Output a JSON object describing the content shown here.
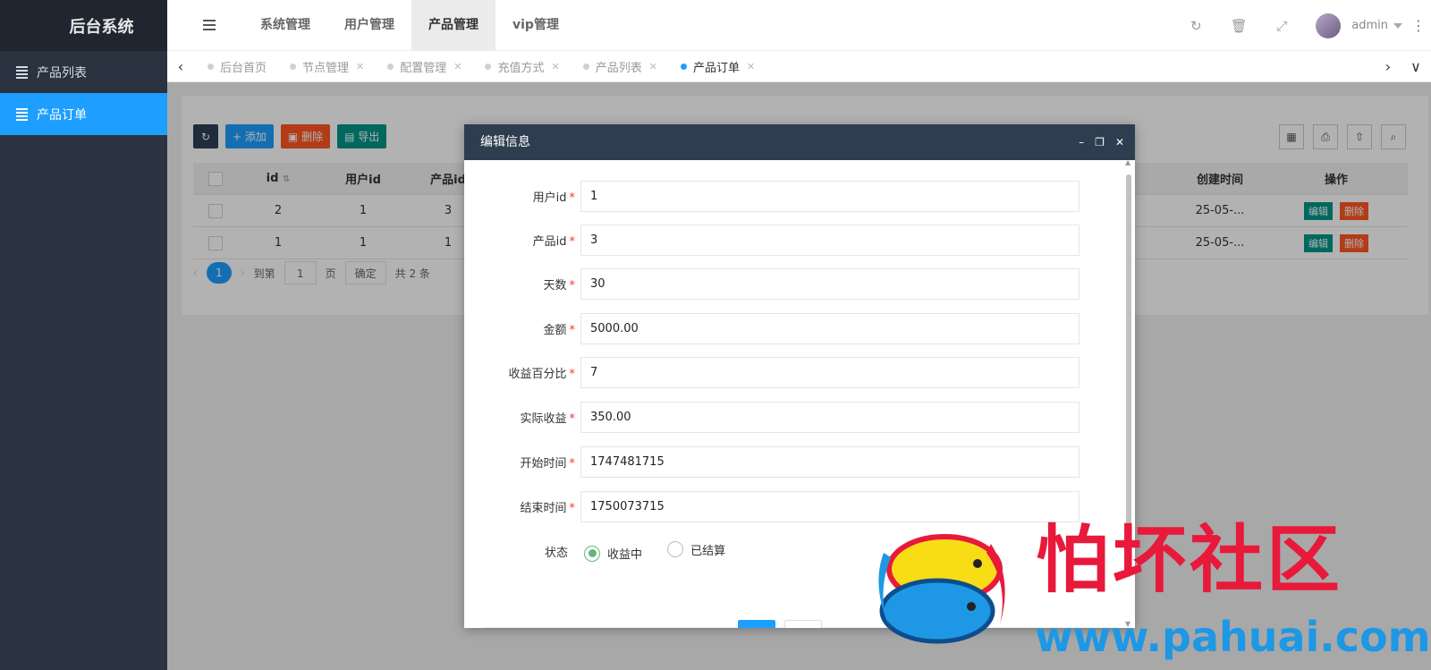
{
  "app": {
    "title": "后台系统",
    "user": "admin"
  },
  "sidebar": {
    "items": [
      {
        "label": "产品列表",
        "active": false
      },
      {
        "label": "产品订单",
        "active": true
      }
    ]
  },
  "topnav": [
    {
      "label": "系统管理",
      "active": false
    },
    {
      "label": "用户管理",
      "active": false
    },
    {
      "label": "产品管理",
      "active": true
    },
    {
      "label": "vip管理",
      "active": false
    }
  ],
  "header_icons": [
    "refresh-icon",
    "trash-icon",
    "fullscreen-icon",
    "more-vertical-icon"
  ],
  "tabs": [
    {
      "label": "后台首页",
      "closable": false,
      "active": false
    },
    {
      "label": "节点管理",
      "closable": true,
      "active": false
    },
    {
      "label": "配置管理",
      "closable": true,
      "active": false
    },
    {
      "label": "充值方式",
      "closable": true,
      "active": false
    },
    {
      "label": "产品列表",
      "closable": true,
      "active": false
    },
    {
      "label": "产品订单",
      "closable": true,
      "active": true
    }
  ],
  "toolbar": {
    "add": "添加",
    "delete": "删除",
    "export": "导出"
  },
  "table": {
    "headers": {
      "id": "id",
      "user_id": "用户id",
      "product_id": "产品id",
      "create_time": "创建时间",
      "ops": "操作"
    },
    "rows": [
      {
        "id": "2",
        "user_id": "1",
        "product_id": "3",
        "create_time": "25-05-..."
      },
      {
        "id": "1",
        "user_id": "1",
        "product_id": "1",
        "create_time": "25-05-..."
      }
    ],
    "edit_label": "编辑",
    "delete_label": "删除"
  },
  "pager": {
    "current": "1",
    "goto_label": "到第",
    "page_input": "1",
    "page_unit": "页",
    "confirm": "确定",
    "total": "共 2 条"
  },
  "dialog": {
    "title": "编辑信息",
    "fields": [
      {
        "label": "用户id",
        "value": "1"
      },
      {
        "label": "产品id",
        "value": "3"
      },
      {
        "label": "天数",
        "value": "30"
      },
      {
        "label": "金额",
        "value": "5000.00"
      },
      {
        "label": "收益百分比",
        "value": "7"
      },
      {
        "label": "实际收益",
        "value": "350.00"
      },
      {
        "label": "开始时间",
        "value": "1747481715"
      },
      {
        "label": "结束时间",
        "value": "1750073715"
      }
    ],
    "status": {
      "label": "状态",
      "options": [
        "收益中",
        "已结算"
      ],
      "selected": "收益中"
    }
  },
  "watermark": {
    "text": "怕坏社区",
    "url": "www.pahuai.com"
  },
  "colors": {
    "sidebar": "#2b3340",
    "accent": "#1e9fff",
    "edit": "#009688",
    "danger": "#ff5722",
    "dialog_header": "#2f3d50",
    "watermark_red": "#e8193a",
    "watermark_blue": "#1e98e5"
  }
}
